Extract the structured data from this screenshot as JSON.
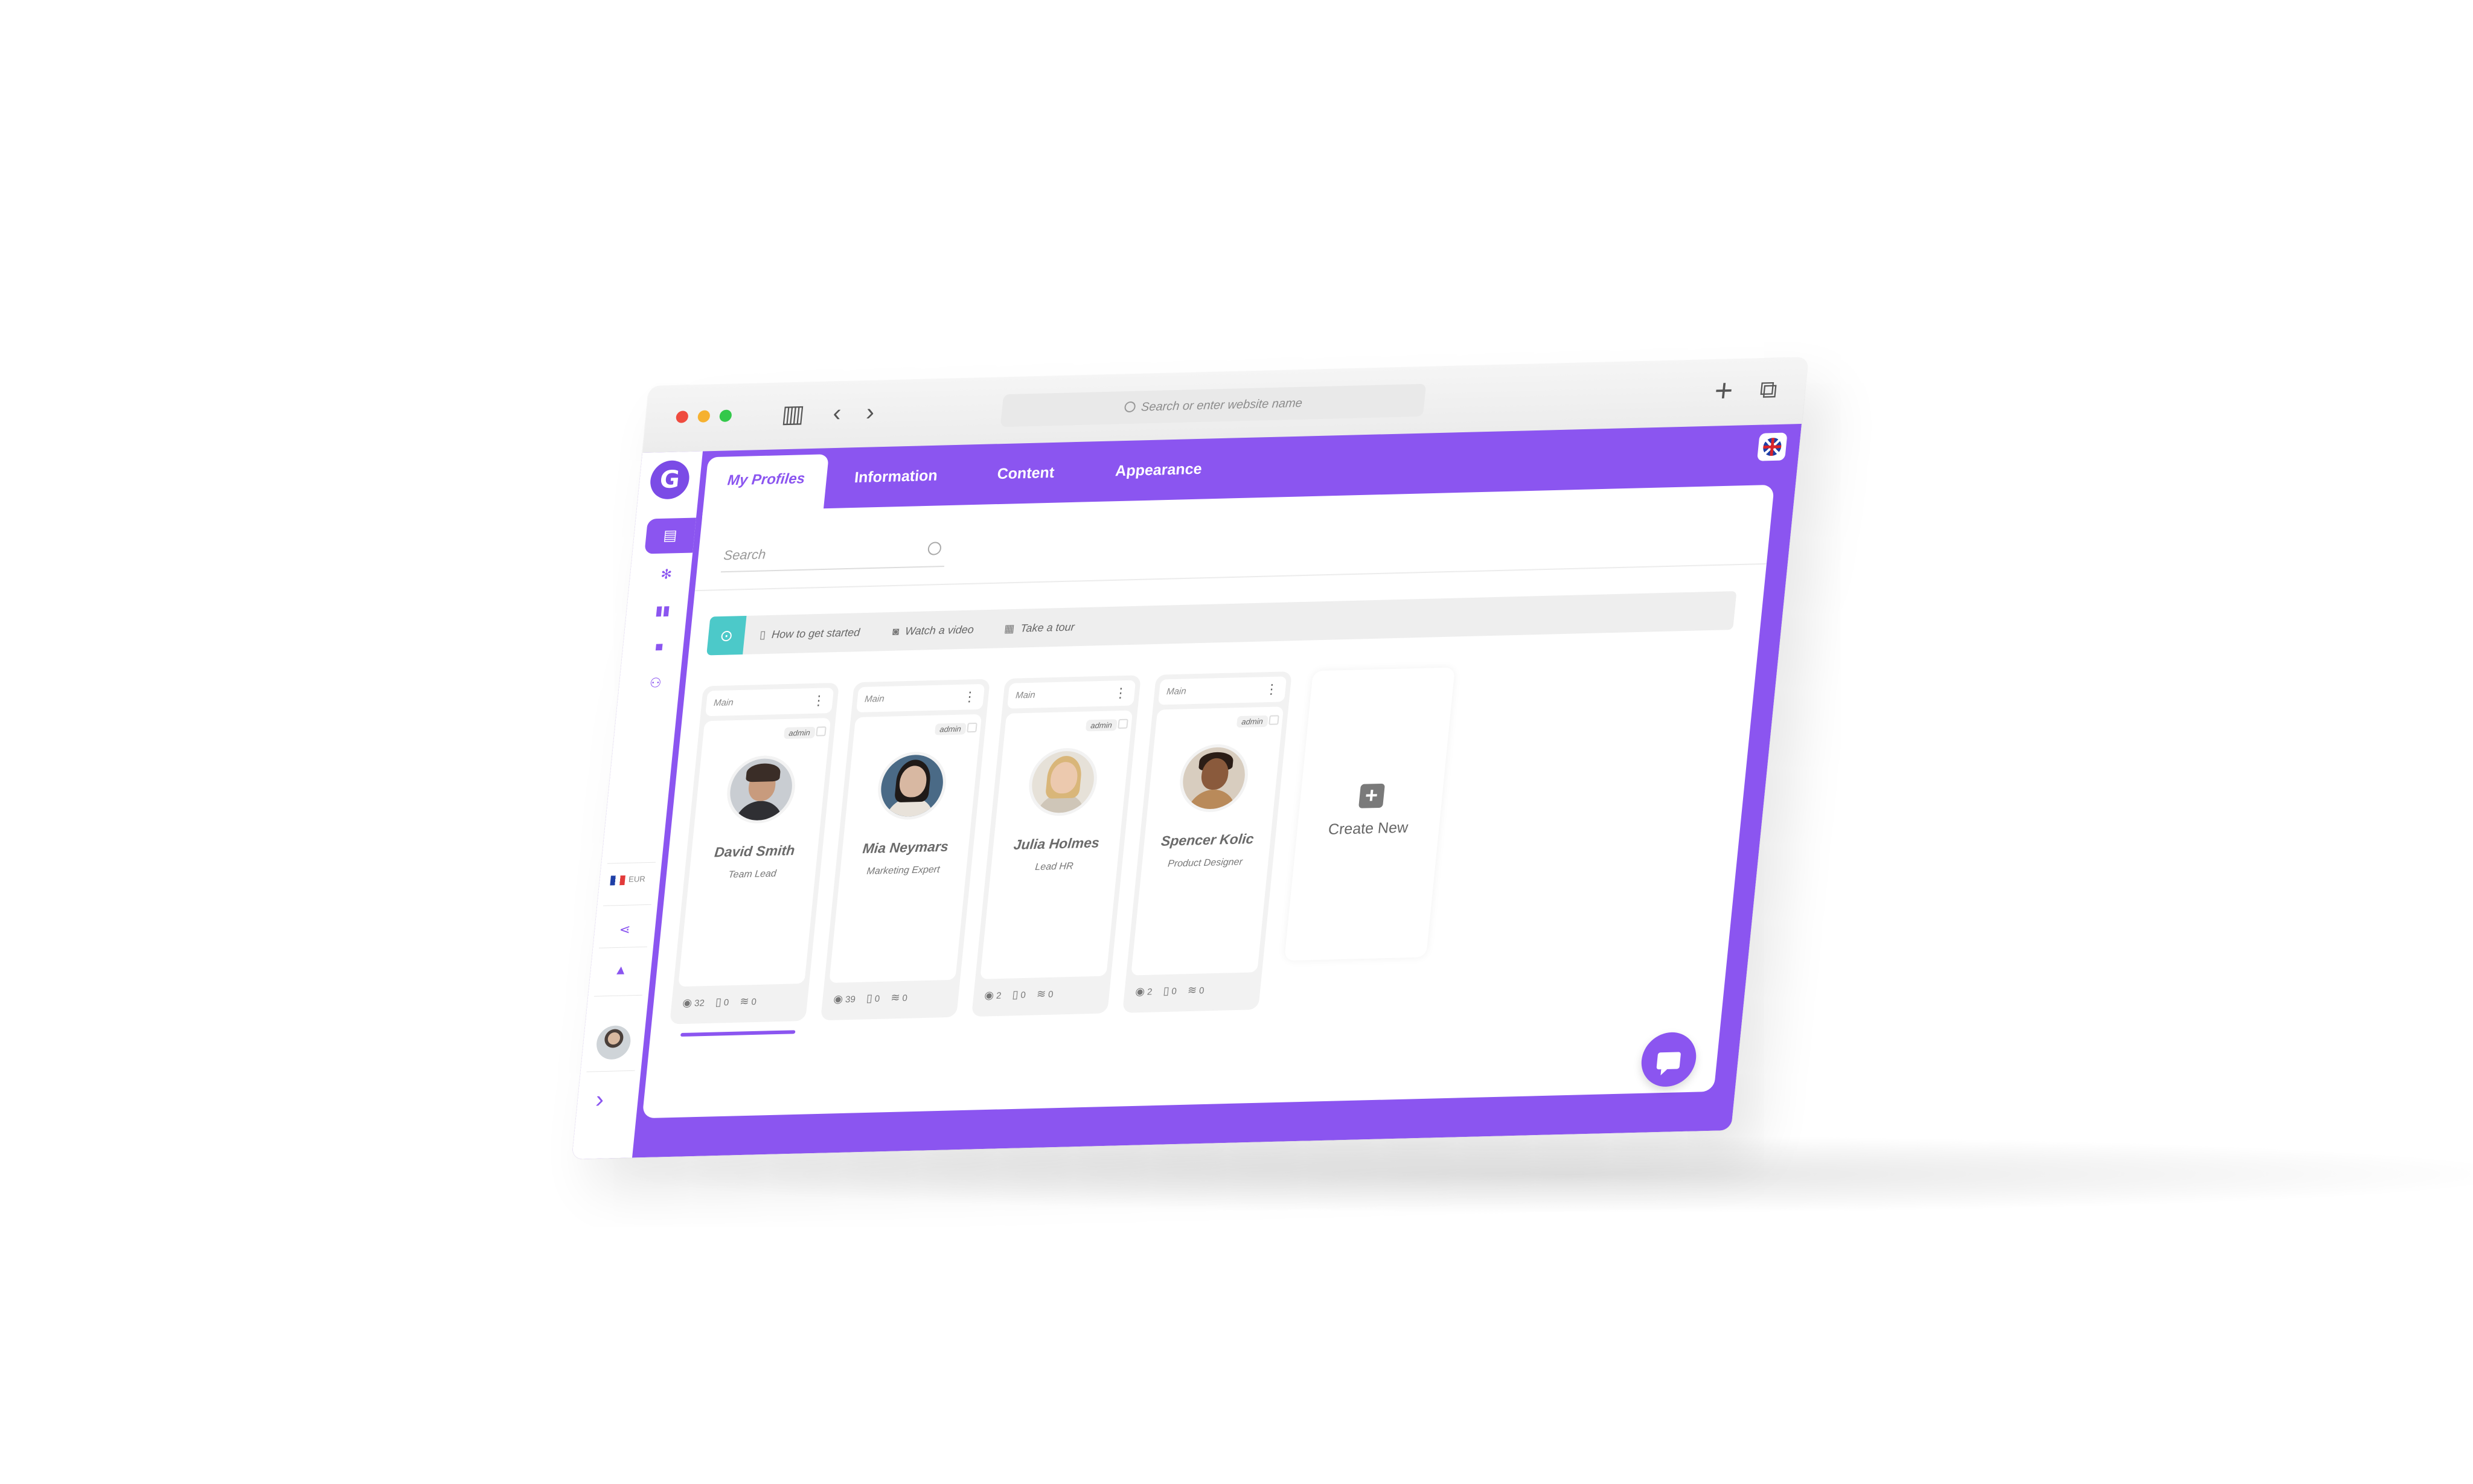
{
  "browser": {
    "url_placeholder": "Search or enter website name",
    "icons": [
      "sidebar-toggle-icon",
      "back-icon",
      "forward-icon",
      "new-tab-icon",
      "tabs-overview-icon"
    ]
  },
  "app": {
    "logo_letter": "G",
    "tabs": [
      "My Profiles",
      "Information",
      "Content",
      "Appearance"
    ],
    "accent_color": "#8b55f0",
    "sidebar": {
      "language_short": "EUR",
      "icons": [
        "profiles-icon",
        "people-icon",
        "analytics-icon",
        "shopping-bag-icon",
        "team-icon",
        "share-icon",
        "bell-icon"
      ]
    },
    "search_placeholder": "Search",
    "help": {
      "items": [
        "How to get started",
        "Watch a video",
        "Take a tour"
      ]
    },
    "cards": [
      {
        "group": "Main",
        "badge": "admin",
        "name": "David Smith",
        "role": "Team Lead",
        "views": "32",
        "taps": "0",
        "scans": "0"
      },
      {
        "group": "Main",
        "badge": "admin",
        "name": "Mia Neymars",
        "role": "Marketing Expert",
        "views": "39",
        "taps": "0",
        "scans": "0"
      },
      {
        "group": "Main",
        "badge": "admin",
        "name": "Julia Holmes",
        "role": "Lead HR",
        "views": "2",
        "taps": "0",
        "scans": "0"
      },
      {
        "group": "Main",
        "badge": "admin",
        "name": "Spencer Kolic",
        "role": "Product Designer",
        "views": "2",
        "taps": "0",
        "scans": "0"
      }
    ],
    "create_new_label": "Create New"
  }
}
